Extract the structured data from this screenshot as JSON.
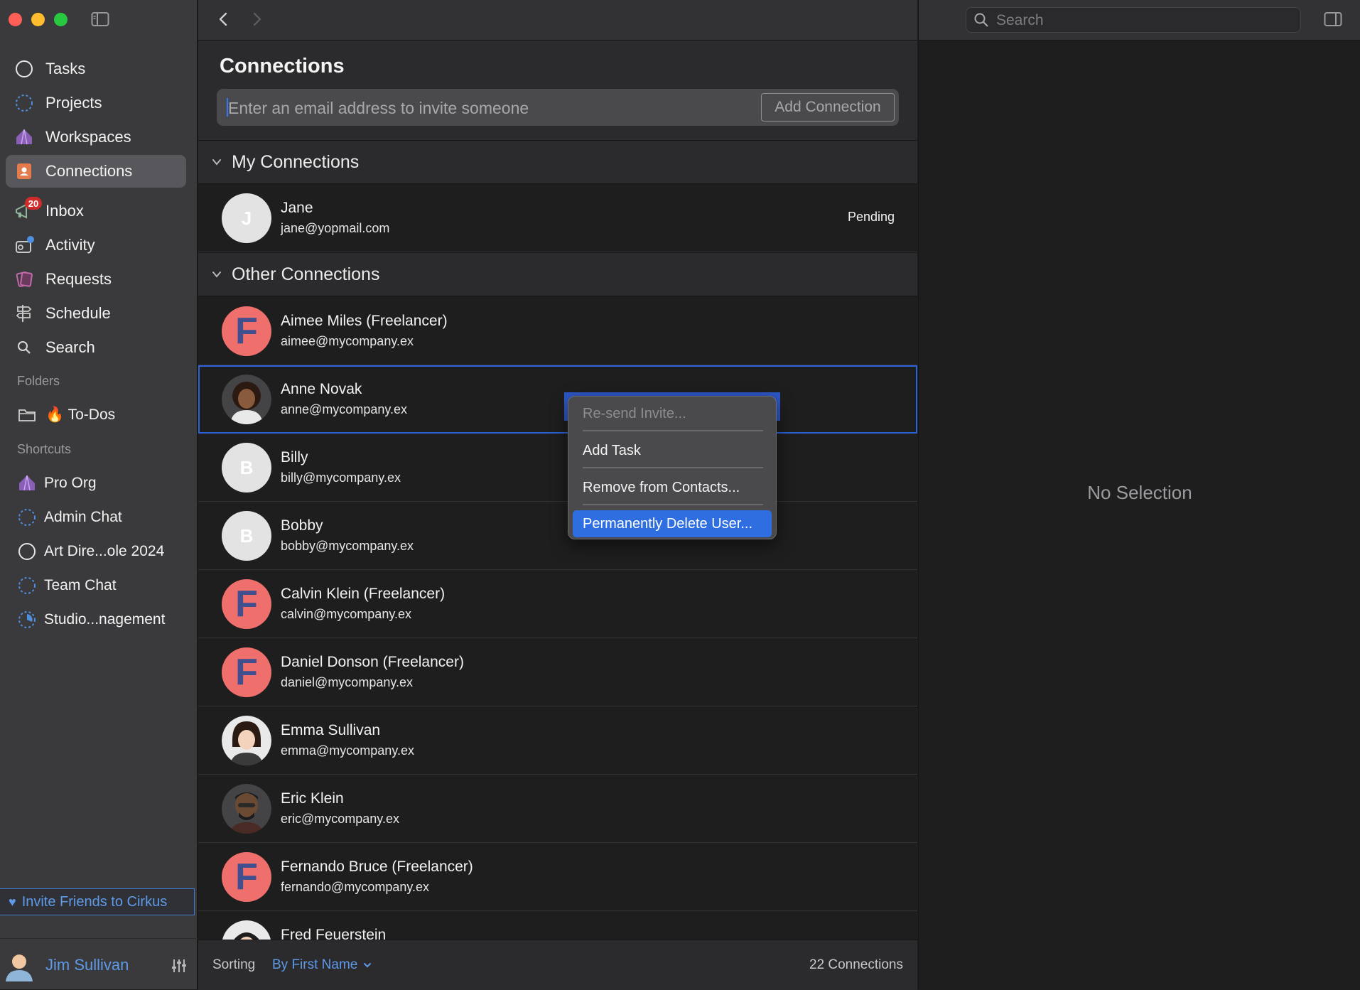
{
  "sidebar": {
    "nav": [
      {
        "label": "Tasks",
        "icon": "circle-icon"
      },
      {
        "label": "Projects",
        "icon": "dotted-circle-icon"
      },
      {
        "label": "Workspaces",
        "icon": "circus-tent-icon"
      },
      {
        "label": "Connections",
        "icon": "contacts-book-icon"
      },
      {
        "label": "Inbox",
        "icon": "megaphone-icon",
        "badge": "20"
      },
      {
        "label": "Activity",
        "icon": "activity-icon"
      },
      {
        "label": "Requests",
        "icon": "requests-cards-icon"
      },
      {
        "label": "Schedule",
        "icon": "signpost-icon"
      },
      {
        "label": "Search",
        "icon": "search-icon"
      }
    ],
    "folders_heading": "Folders",
    "folders": [
      {
        "label": "🔥 To-Dos",
        "icon": "folder-icon"
      }
    ],
    "shortcuts_heading": "Shortcuts",
    "shortcuts": [
      {
        "label": "Pro Org",
        "icon": "circus-tent-icon"
      },
      {
        "label": "Admin Chat",
        "icon": "dotted-circle-icon"
      },
      {
        "label": "Art Dire...ole 2024",
        "icon": "circle-icon"
      },
      {
        "label": "Team Chat",
        "icon": "dotted-circle-icon"
      },
      {
        "label": "Studio...nagement",
        "icon": "progress-circle-icon"
      }
    ],
    "invite_button": "Invite Friends to Cirkus",
    "user_name": "Jim Sullivan"
  },
  "main": {
    "title": "Connections",
    "invite_placeholder": "Enter an email address to invite someone",
    "add_button": "Add Connection",
    "my_connections_heading": "My Connections",
    "my_connections": [
      {
        "name": "Jane",
        "email": "jane@yopmail.com",
        "status": "Pending",
        "initial": "J"
      }
    ],
    "other_connections_heading": "Other Connections",
    "other_connections": [
      {
        "name": "Aimee Miles (Freelancer)",
        "email": "aimee@mycompany.ex"
      },
      {
        "name": "Anne Novak",
        "email": "anne@mycompany.ex"
      },
      {
        "name": "Billy",
        "email": "billy@mycompany.ex",
        "initial": "B"
      },
      {
        "name": "Bobby",
        "email": "bobby@mycompany.ex",
        "initial": "B"
      },
      {
        "name": "Calvin Klein (Freelancer)",
        "email": "calvin@mycompany.ex"
      },
      {
        "name": "Daniel Donson (Freelancer)",
        "email": "daniel@mycompany.ex"
      },
      {
        "name": "Emma Sullivan",
        "email": "emma@mycompany.ex"
      },
      {
        "name": "Eric Klein",
        "email": "eric@mycompany.ex"
      },
      {
        "name": "Fernando Bruce (Freelancer)",
        "email": "fernando@mycompany.ex"
      },
      {
        "name": "Fred Feuerstein",
        "email": ""
      }
    ],
    "sorting_label": "Sorting",
    "sorting_value": "By First Name",
    "count_label": "22 Connections"
  },
  "context_menu": {
    "items": [
      {
        "label": "Re-send Invite...",
        "enabled": false
      },
      {
        "label": "Add Task",
        "enabled": true
      },
      {
        "label": "Remove from Contacts...",
        "enabled": true
      },
      {
        "label": "Permanently Delete User...",
        "enabled": true,
        "highlighted": true
      }
    ]
  },
  "detail": {
    "search_placeholder": "Search",
    "empty_text": "No Selection"
  },
  "colors": {
    "accent": "#2f6ee0",
    "selection_border": "#2e62d8",
    "badge": "#d02b2b",
    "freelancer_avatar": "#ee6f6b"
  }
}
